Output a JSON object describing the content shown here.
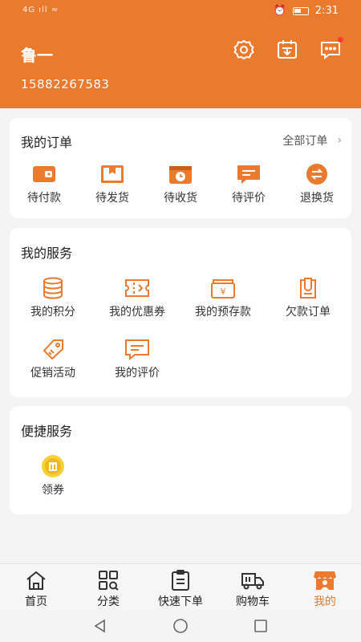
{
  "status_bar": {
    "signal": "4G",
    "time": "2:31"
  },
  "profile": {
    "name": "鲁一",
    "phone": "15882267583"
  },
  "header_icons": [
    "settings-icon",
    "sign-in-icon",
    "message-icon"
  ],
  "orders": {
    "title": "我的订单",
    "all_label": "全部订单",
    "items": [
      {
        "label": "待付款",
        "icon": "wallet-icon"
      },
      {
        "label": "待发货",
        "icon": "box-icon"
      },
      {
        "label": "待收货",
        "icon": "delivery-icon"
      },
      {
        "label": "待评价",
        "icon": "comment-icon"
      },
      {
        "label": "退换货",
        "icon": "exchange-icon"
      }
    ]
  },
  "services": {
    "title": "我的服务",
    "items": [
      {
        "label": "我的积分",
        "icon": "coins-icon"
      },
      {
        "label": "我的优惠券",
        "icon": "coupon-icon"
      },
      {
        "label": "我的预存款",
        "icon": "deposit-icon"
      },
      {
        "label": "欠款订单",
        "icon": "debt-icon"
      },
      {
        "label": "促销活动",
        "icon": "tag-icon"
      },
      {
        "label": "我的评价",
        "icon": "review-icon"
      }
    ]
  },
  "quick": {
    "title": "便捷服务",
    "items": [
      {
        "label": "领券",
        "icon": "voucher-icon"
      }
    ]
  },
  "tabbar": {
    "items": [
      {
        "label": "首页",
        "icon": "home-icon"
      },
      {
        "label": "分类",
        "icon": "category-icon"
      },
      {
        "label": "快速下单",
        "icon": "clipboard-icon"
      },
      {
        "label": "购物车",
        "icon": "truck-icon"
      },
      {
        "label": "我的",
        "icon": "shop-icon",
        "active": true
      }
    ]
  },
  "colors": {
    "accent": "#ea7a2e",
    "background": "#f4f4f4"
  }
}
